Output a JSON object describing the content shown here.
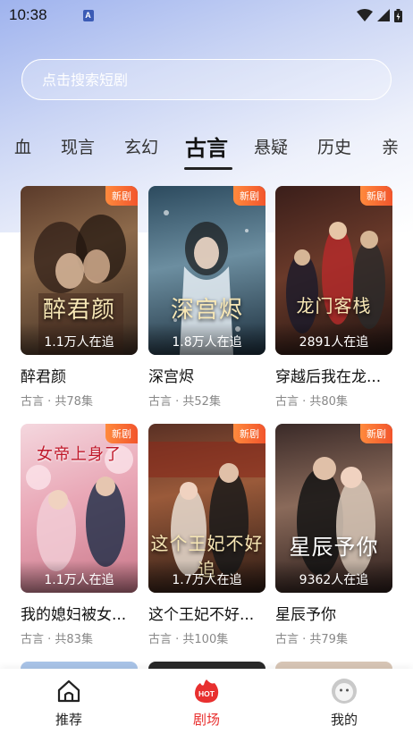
{
  "status_bar": {
    "time": "10:38",
    "notification_icon_letter": "A",
    "icons": [
      "wifi-icon",
      "signal-icon",
      "battery-icon"
    ]
  },
  "search": {
    "placeholder": "点击搜索短剧"
  },
  "tabs": [
    {
      "label": "血"
    },
    {
      "label": "现言"
    },
    {
      "label": "玄幻"
    },
    {
      "label": "古言",
      "active": true
    },
    {
      "label": "悬疑"
    },
    {
      "label": "历史"
    },
    {
      "label": "亲"
    }
  ],
  "badge_label": "新剧",
  "dramas": [
    {
      "title": "醉君颜",
      "meta": "古言 · 共78集",
      "viewers": "1.1万人在追",
      "poster_text": "醉君颜"
    },
    {
      "title": "深宫烬",
      "meta": "古言 · 共52集",
      "viewers": "1.8万人在追",
      "poster_text": "深宫烬"
    },
    {
      "title": "穿越后我在龙...",
      "meta": "古言 · 共80集",
      "viewers": "2891人在追",
      "poster_text": "龙门客栈"
    },
    {
      "title": "我的媳妇被女...",
      "meta": "古言 · 共83集",
      "viewers": "1.1万人在追",
      "poster_text": "女帝上身了"
    },
    {
      "title": "这个王妃不好...",
      "meta": "古言 · 共100集",
      "viewers": "1.7万人在追",
      "poster_text": "这个王妃不好追"
    },
    {
      "title": "星辰予你",
      "meta": "古言 · 共79集",
      "viewers": "9362人在追",
      "poster_text": "星辰予你"
    }
  ],
  "bottom_nav": [
    {
      "label": "推荐",
      "icon": "home-icon"
    },
    {
      "label": "剧场",
      "icon": "hot-icon",
      "active": true,
      "icon_text": "HOT"
    },
    {
      "label": "我的",
      "icon": "profile-icon"
    }
  ],
  "colors": {
    "accent": "#e8302f",
    "badge": "#f2552c",
    "header_gradient_top": "#9fb3ee"
  }
}
